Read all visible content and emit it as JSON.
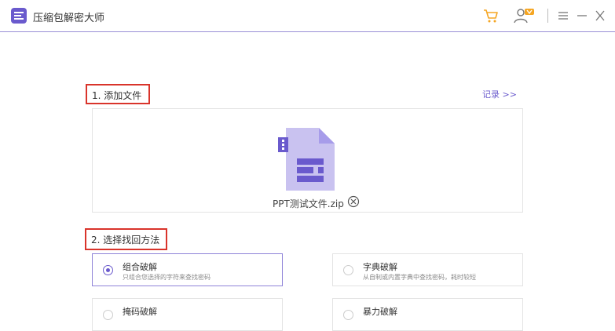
{
  "app": {
    "title": "压缩包解密大师"
  },
  "colors": {
    "accent": "#6a5acd",
    "highlight_border": "#d9342b",
    "cart": "#f5a623"
  },
  "icons": [
    "app-logo-icon",
    "cart-icon",
    "user-vip-icon",
    "menu-icon",
    "minimize-icon",
    "close-icon",
    "zip-file-icon",
    "remove-file-icon"
  ],
  "step1": {
    "label": "1. 添加文件",
    "records_link": "记录 >>"
  },
  "file": {
    "name": "PPT测试文件.zip"
  },
  "step2": {
    "label": "2. 选择找回方法"
  },
  "methods": [
    {
      "title": "组合破解",
      "desc": "只组合您选择的字符来查找密码",
      "selected": true
    },
    {
      "title": "字典破解",
      "desc": "从自制或内置字典中查找密码，耗时较短",
      "selected": false
    },
    {
      "title": "掩码破解",
      "desc": "",
      "selected": false
    },
    {
      "title": "暴力破解",
      "desc": "",
      "selected": false
    }
  ]
}
